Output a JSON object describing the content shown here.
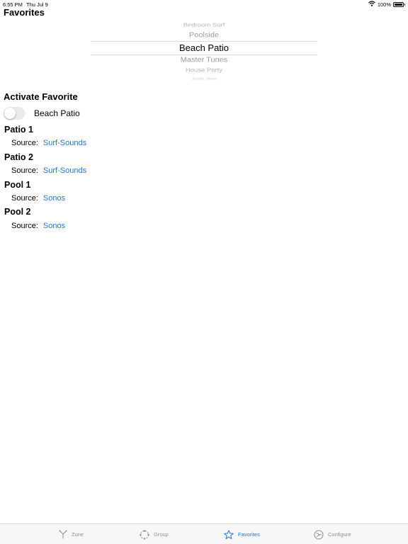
{
  "status_bar": {
    "time": "6:55 PM",
    "date": "Thu Jul 9",
    "battery": "100%",
    "battery_level": 1.0
  },
  "page_title": "Favorites",
  "picker": {
    "items": [
      "Bedroom Surf",
      "Poolside",
      "Beach Patio",
      "Master Tunes",
      "House Party",
      "Josh Jam"
    ],
    "selected": "Beach Patio"
  },
  "activate": {
    "title": "Activate Favorite",
    "toggle_on": false,
    "label": "Beach Patio"
  },
  "zones": [
    {
      "name": "Patio 1",
      "source_label": "Source:",
      "source": "Surf-Sounds"
    },
    {
      "name": "Patio 2",
      "source_label": "Source:",
      "source": "Surf-Sounds"
    },
    {
      "name": "Pool 1",
      "source_label": "Source:",
      "source": "Sonos"
    },
    {
      "name": "Pool 2",
      "source_label": "Source:",
      "source": "Sonos"
    }
  ],
  "tab_bar": {
    "tabs": [
      {
        "label": "Zone",
        "icon": "zone-icon",
        "active": false
      },
      {
        "label": "Group",
        "icon": "group-icon",
        "active": false
      },
      {
        "label": "Favorites",
        "icon": "star-icon",
        "active": true
      },
      {
        "label": "Configure",
        "icon": "configure-icon",
        "active": false
      }
    ]
  },
  "colors": {
    "accent": "#1a7ae0",
    "inactive": "#8e8e93",
    "toggle_off": "#e9e9eb"
  }
}
